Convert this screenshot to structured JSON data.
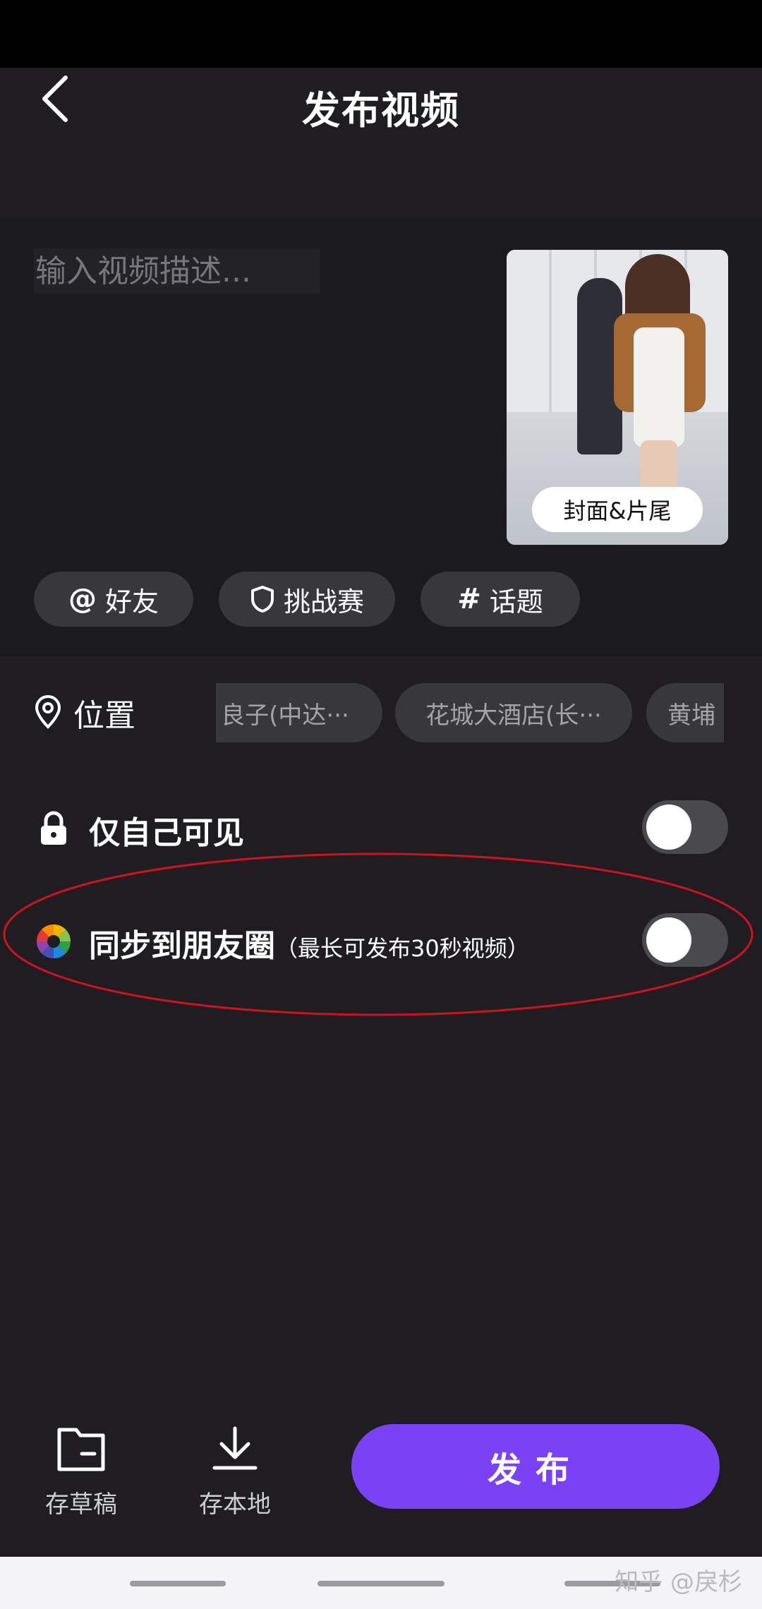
{
  "header": {
    "title": "发布视频"
  },
  "description": {
    "placeholder": "输入视频描述..."
  },
  "cover": {
    "button_label": "封面&片尾"
  },
  "chips": [
    {
      "label": "好友"
    },
    {
      "label": "挑战赛"
    },
    {
      "label": "话题"
    }
  ],
  "location": {
    "label": "位置",
    "suggestions": [
      "良子(中达···",
      "花城大酒店(长···",
      "黄埔"
    ]
  },
  "privacy": {
    "label": "仅自己可见",
    "enabled": false
  },
  "moments": {
    "label": "同步到朋友圈",
    "note": "（最长可发布30秒视频）",
    "enabled": false
  },
  "bottom": {
    "draft_label": "存草稿",
    "local_label": "存本地",
    "publish_label": "发布"
  },
  "watermark": "知乎 @戾杉",
  "colors": {
    "accent": "#7a42f4",
    "highlight": "#d0121e"
  }
}
